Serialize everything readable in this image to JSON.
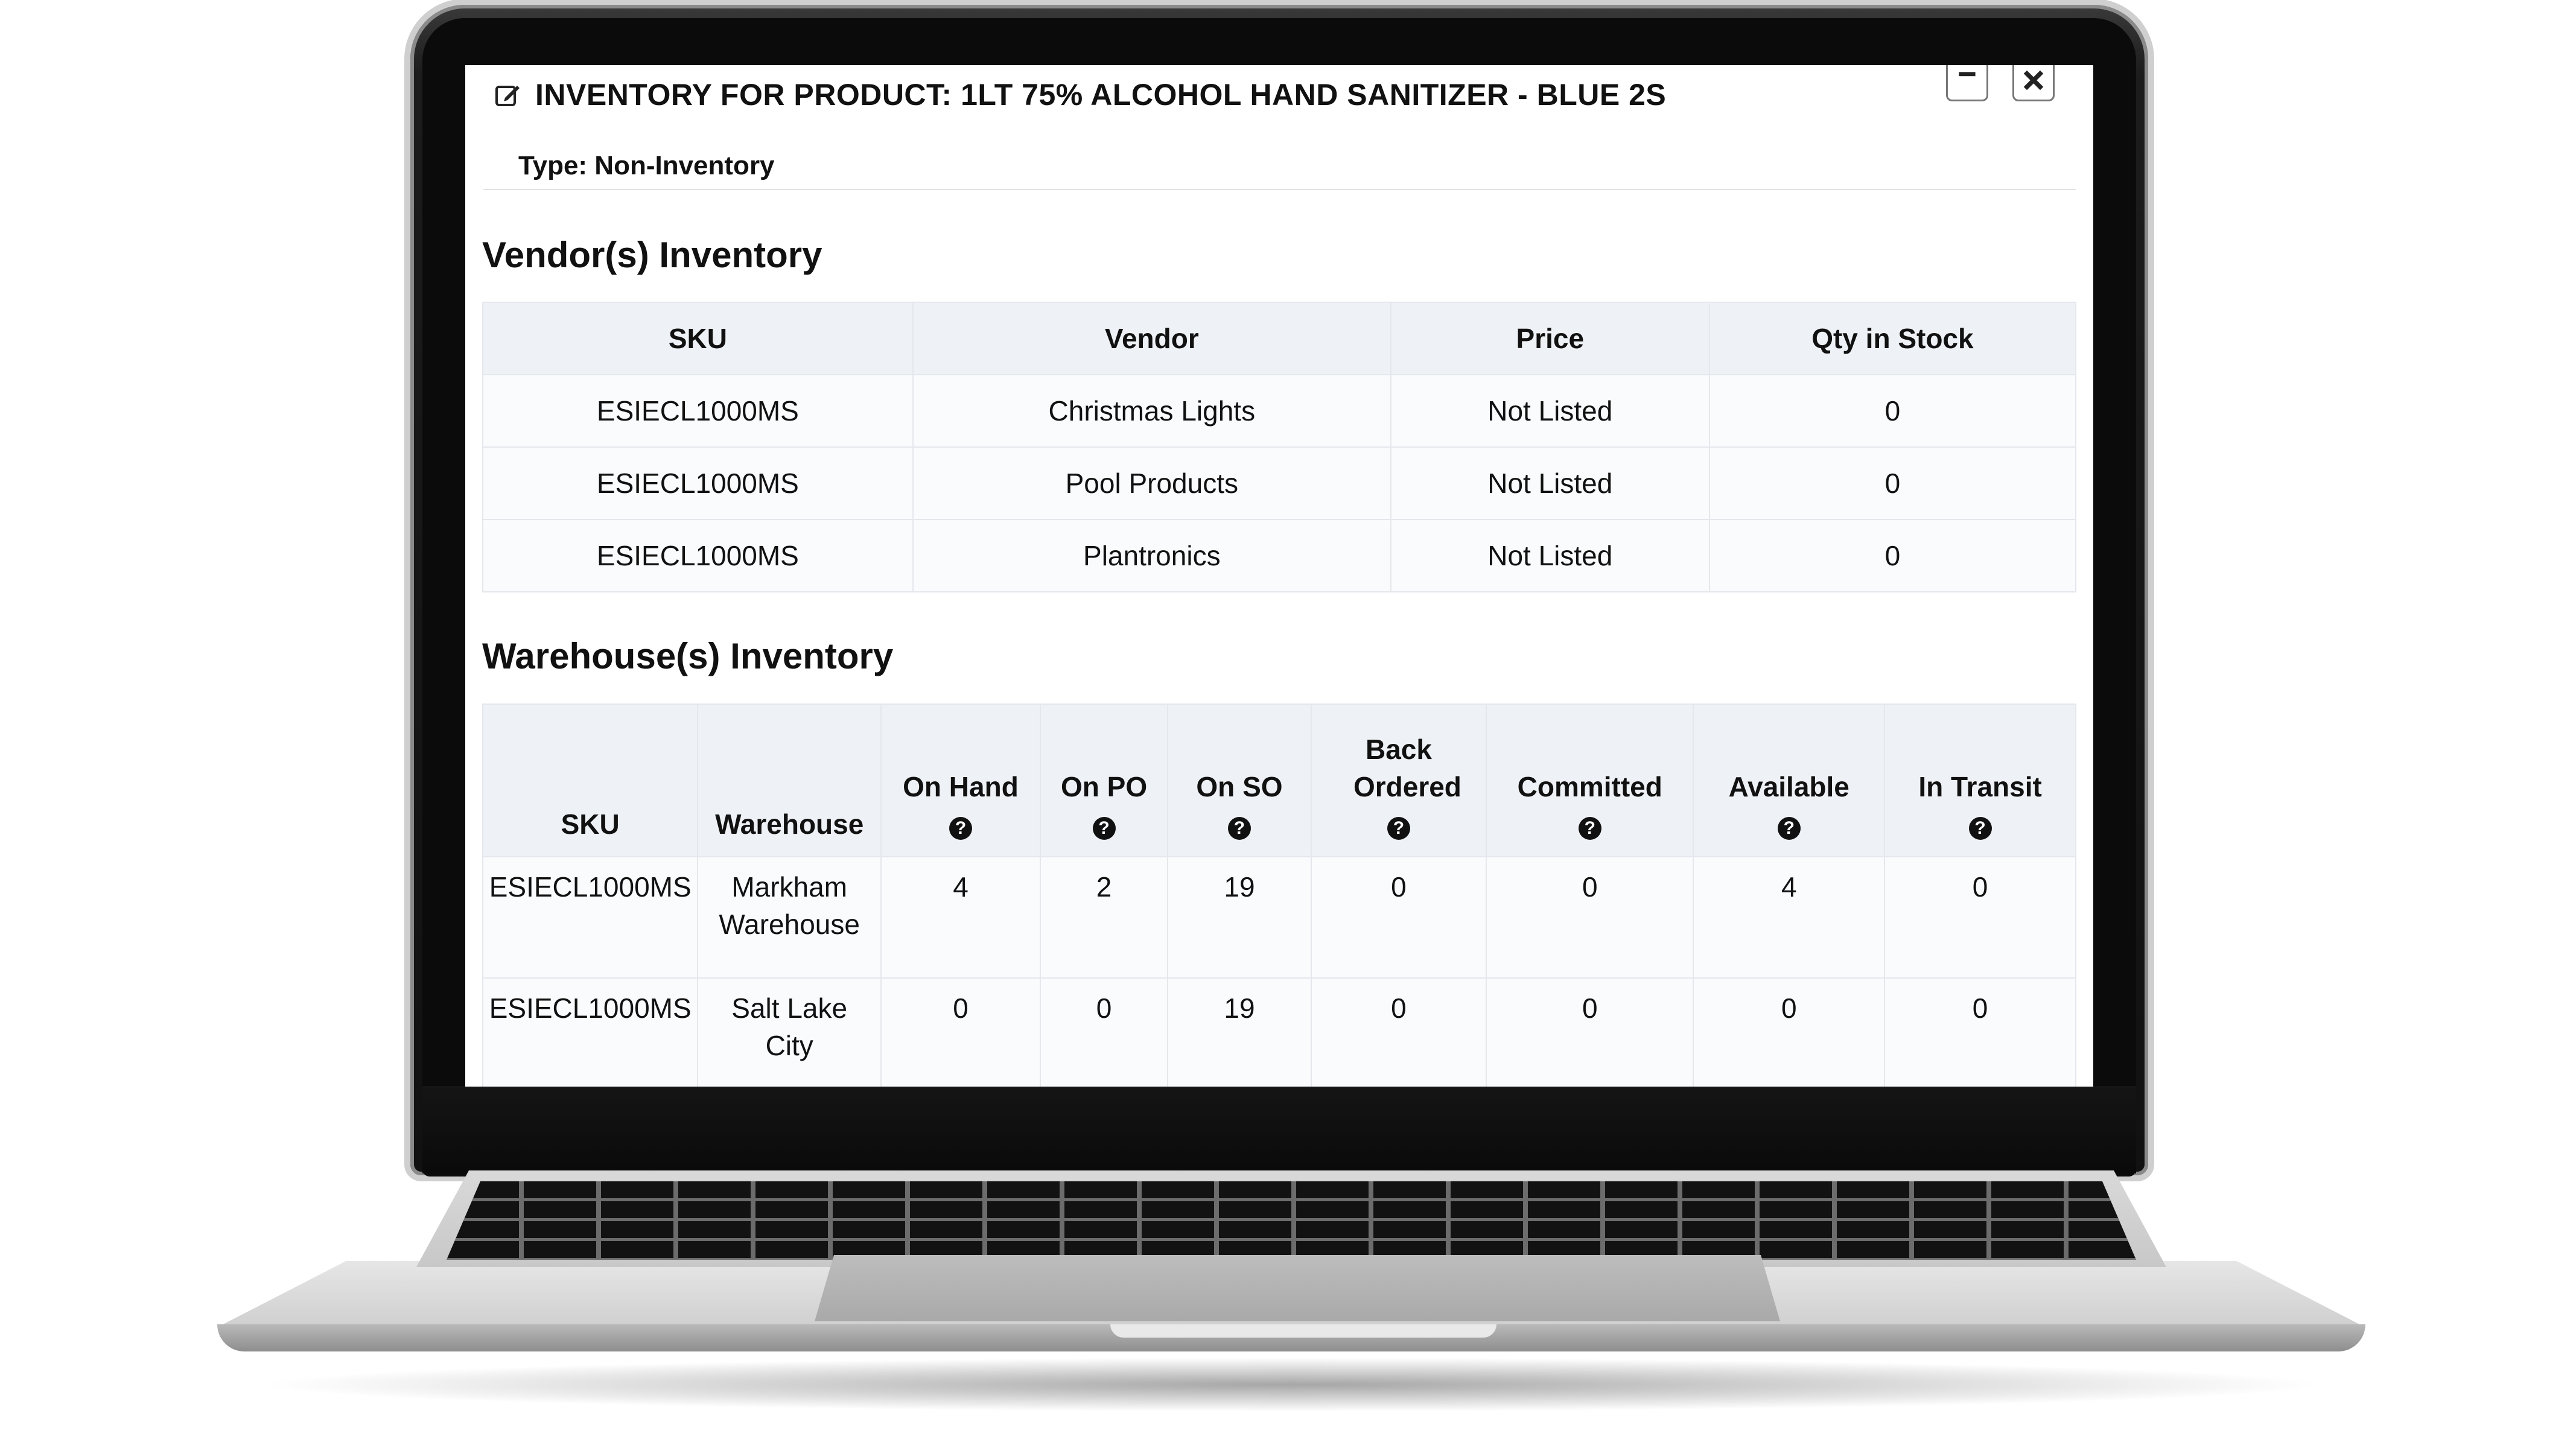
{
  "dialog": {
    "title": "INVENTORY FOR PRODUCT: 1LT 75% ALCOHOL HAND SANITIZER - BLUE 2S",
    "title_icon": "edit-icon",
    "type_line": "Type: Non-Inventory",
    "minimize_icon": "minimize-icon",
    "close_icon": "close-icon"
  },
  "vendor_section": {
    "title": "Vendor(s) Inventory",
    "columns": [
      "SKU",
      "Vendor",
      "Price",
      "Qty in Stock"
    ],
    "rows": [
      [
        "ESIECL1000MS",
        "Christmas Lights",
        "Not Listed",
        "0"
      ],
      [
        "ESIECL1000MS",
        "Pool Products",
        "Not Listed",
        "0"
      ],
      [
        "ESIECL1000MS",
        "Plantronics",
        "Not Listed",
        "0"
      ]
    ]
  },
  "warehouse_section": {
    "title": "Warehouse(s) Inventory",
    "columns": [
      {
        "label": "SKU",
        "help": false
      },
      {
        "label": "Warehouse",
        "help": false
      },
      {
        "label": "On Hand",
        "help": true
      },
      {
        "label": "On PO",
        "help": true
      },
      {
        "label": "On SO",
        "help": true
      },
      {
        "label": "Back Ordered",
        "help": true
      },
      {
        "label": "Committed",
        "help": true
      },
      {
        "label": "Available",
        "help": true
      },
      {
        "label": "In Transit",
        "help": true
      }
    ],
    "help_glyph": "?",
    "rows": [
      [
        "ESIECL1000MS",
        "Markham Warehouse",
        "4",
        "2",
        "19",
        "0",
        "0",
        "4",
        "0"
      ],
      [
        "ESIECL1000MS",
        "Salt Lake City",
        "0",
        "0",
        "19",
        "0",
        "0",
        "0",
        "0"
      ]
    ]
  }
}
